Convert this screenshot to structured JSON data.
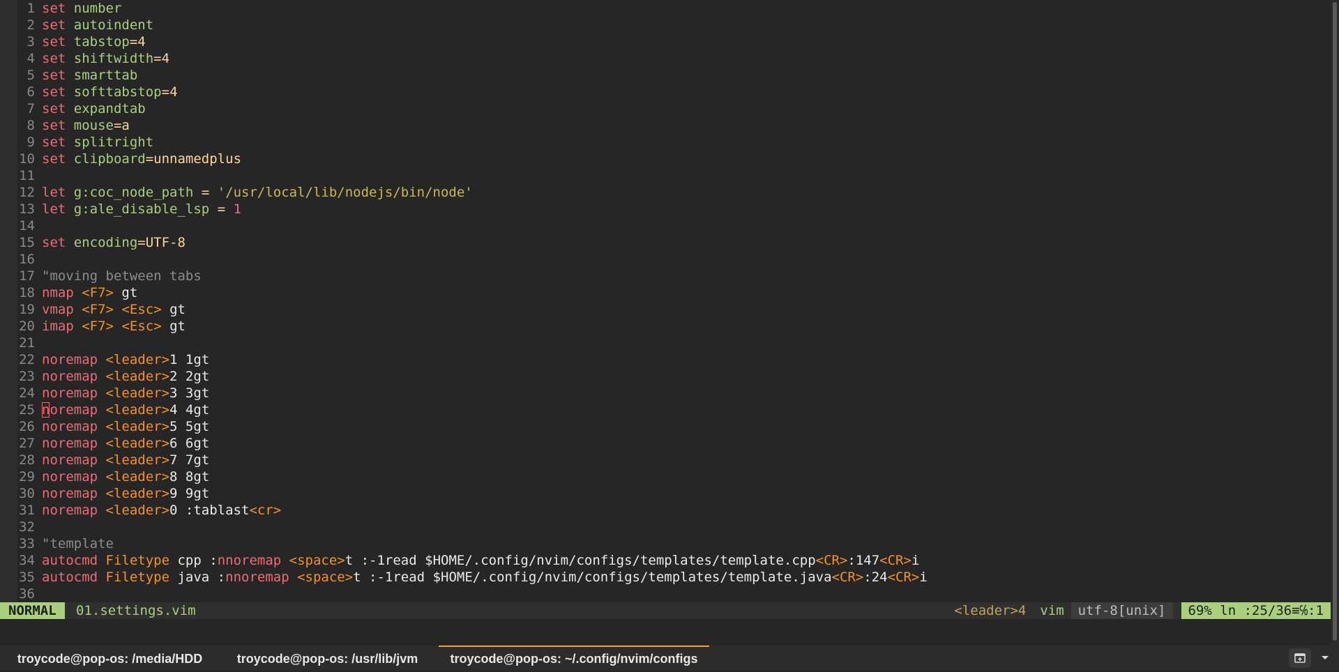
{
  "editor": {
    "lines": [
      {
        "n": "1",
        "segs": [
          [
            "set",
            "kw"
          ],
          [
            " ",
            ""
          ],
          [
            "number",
            "opt"
          ]
        ]
      },
      {
        "n": "2",
        "segs": [
          [
            "set",
            "kw"
          ],
          [
            " ",
            ""
          ],
          [
            "autoindent",
            "opt"
          ]
        ]
      },
      {
        "n": "3",
        "segs": [
          [
            "set",
            "kw"
          ],
          [
            " ",
            ""
          ],
          [
            "tabstop",
            "opt"
          ],
          [
            "=4",
            "eq"
          ]
        ]
      },
      {
        "n": "4",
        "segs": [
          [
            "set",
            "kw"
          ],
          [
            " ",
            ""
          ],
          [
            "shiftwidth",
            "opt"
          ],
          [
            "=4",
            "eq"
          ]
        ]
      },
      {
        "n": "5",
        "segs": [
          [
            "set",
            "kw"
          ],
          [
            " ",
            ""
          ],
          [
            "smarttab",
            "opt"
          ]
        ]
      },
      {
        "n": "6",
        "segs": [
          [
            "set",
            "kw"
          ],
          [
            " ",
            ""
          ],
          [
            "softtabstop",
            "opt"
          ],
          [
            "=4",
            "eq"
          ]
        ]
      },
      {
        "n": "7",
        "segs": [
          [
            "set",
            "kw"
          ],
          [
            " ",
            ""
          ],
          [
            "expandtab",
            "opt"
          ]
        ]
      },
      {
        "n": "8",
        "segs": [
          [
            "set",
            "kw"
          ],
          [
            " ",
            ""
          ],
          [
            "mouse",
            "opt"
          ],
          [
            "=a",
            "eq"
          ]
        ]
      },
      {
        "n": "9",
        "segs": [
          [
            "set",
            "kw"
          ],
          [
            " ",
            ""
          ],
          [
            "splitright",
            "opt"
          ]
        ]
      },
      {
        "n": "10",
        "segs": [
          [
            "set",
            "kw"
          ],
          [
            " ",
            ""
          ],
          [
            "clipboard",
            "opt"
          ],
          [
            "=unnamedplus",
            "eq"
          ]
        ]
      },
      {
        "n": "11",
        "segs": []
      },
      {
        "n": "12",
        "segs": [
          [
            "let",
            "kw"
          ],
          [
            " ",
            ""
          ],
          [
            "g:coc_node_path",
            "opt"
          ],
          [
            " = ",
            "eq"
          ],
          [
            "'/usr/local/lib/nodejs/bin/node'",
            "str"
          ]
        ]
      },
      {
        "n": "13",
        "segs": [
          [
            "let",
            "kw"
          ],
          [
            " ",
            ""
          ],
          [
            "g:ale_disable_lsp",
            "opt"
          ],
          [
            " = ",
            "eq"
          ],
          [
            "1",
            "num"
          ]
        ]
      },
      {
        "n": "14",
        "segs": []
      },
      {
        "n": "15",
        "segs": [
          [
            "set",
            "kw"
          ],
          [
            " ",
            ""
          ],
          [
            "encoding",
            "opt"
          ],
          [
            "=UTF-8",
            "eq"
          ]
        ]
      },
      {
        "n": "16",
        "segs": []
      },
      {
        "n": "17",
        "segs": [
          [
            "\"moving between tabs",
            "cmt"
          ]
        ]
      },
      {
        "n": "18",
        "segs": [
          [
            "nmap",
            "kw"
          ],
          [
            " ",
            ""
          ],
          [
            "<F7>",
            "key"
          ],
          [
            " gt",
            "plain"
          ]
        ]
      },
      {
        "n": "19",
        "segs": [
          [
            "vmap",
            "kw"
          ],
          [
            " ",
            ""
          ],
          [
            "<F7>",
            "key"
          ],
          [
            " ",
            ""
          ],
          [
            "<Esc>",
            "key"
          ],
          [
            " gt",
            "plain"
          ]
        ]
      },
      {
        "n": "20",
        "segs": [
          [
            "imap",
            "kw"
          ],
          [
            " ",
            ""
          ],
          [
            "<F7>",
            "key"
          ],
          [
            " ",
            ""
          ],
          [
            "<Esc>",
            "key"
          ],
          [
            " gt",
            "plain"
          ]
        ]
      },
      {
        "n": "21",
        "segs": []
      },
      {
        "n": "22",
        "segs": [
          [
            "noremap",
            "kw"
          ],
          [
            " ",
            ""
          ],
          [
            "<leader>",
            "key"
          ],
          [
            "1 1gt",
            "plain"
          ]
        ]
      },
      {
        "n": "23",
        "segs": [
          [
            "noremap",
            "kw"
          ],
          [
            " ",
            ""
          ],
          [
            "<leader>",
            "key"
          ],
          [
            "2 2gt",
            "plain"
          ]
        ]
      },
      {
        "n": "24",
        "segs": [
          [
            "noremap",
            "kw"
          ],
          [
            " ",
            ""
          ],
          [
            "<leader>",
            "key"
          ],
          [
            "3 3gt",
            "plain"
          ]
        ]
      },
      {
        "n": "25",
        "segs": [
          [
            "n",
            "kw cursor-char"
          ],
          [
            "oremap",
            "kw"
          ],
          [
            " ",
            ""
          ],
          [
            "<leader>",
            "key"
          ],
          [
            "4 4gt",
            "plain"
          ]
        ]
      },
      {
        "n": "26",
        "segs": [
          [
            "noremap",
            "kw"
          ],
          [
            " ",
            ""
          ],
          [
            "<leader>",
            "key"
          ],
          [
            "5 5gt",
            "plain"
          ]
        ]
      },
      {
        "n": "27",
        "segs": [
          [
            "noremap",
            "kw"
          ],
          [
            " ",
            ""
          ],
          [
            "<leader>",
            "key"
          ],
          [
            "6 6gt",
            "plain"
          ]
        ]
      },
      {
        "n": "28",
        "segs": [
          [
            "noremap",
            "kw"
          ],
          [
            " ",
            ""
          ],
          [
            "<leader>",
            "key"
          ],
          [
            "7 7gt",
            "plain"
          ]
        ]
      },
      {
        "n": "29",
        "segs": [
          [
            "noremap",
            "kw"
          ],
          [
            " ",
            ""
          ],
          [
            "<leader>",
            "key"
          ],
          [
            "8 8gt",
            "plain"
          ]
        ]
      },
      {
        "n": "30",
        "segs": [
          [
            "noremap",
            "kw"
          ],
          [
            " ",
            ""
          ],
          [
            "<leader>",
            "key"
          ],
          [
            "9 9gt",
            "plain"
          ]
        ]
      },
      {
        "n": "31",
        "segs": [
          [
            "noremap",
            "kw"
          ],
          [
            " ",
            ""
          ],
          [
            "<leader>",
            "key"
          ],
          [
            "0 :tablast",
            "plain"
          ],
          [
            "<cr>",
            "key"
          ]
        ]
      },
      {
        "n": "32",
        "segs": []
      },
      {
        "n": "33",
        "segs": [
          [
            "\"template",
            "cmt"
          ]
        ]
      },
      {
        "n": "34",
        "segs": [
          [
            "autocmd",
            "kw"
          ],
          [
            " ",
            ""
          ],
          [
            "Filetype",
            "key"
          ],
          [
            " cpp :",
            "plain"
          ],
          [
            "nnoremap",
            "kw"
          ],
          [
            " ",
            ""
          ],
          [
            "<space>",
            "key"
          ],
          [
            "t :-1read $HOME/.config/nvim/configs/templates/template.cpp",
            "plain"
          ],
          [
            "<CR>",
            "key"
          ],
          [
            ":147",
            "plain"
          ],
          [
            "<CR>",
            "key"
          ],
          [
            "i",
            "plain"
          ]
        ]
      },
      {
        "n": "35",
        "segs": [
          [
            "autocmd",
            "kw"
          ],
          [
            " ",
            ""
          ],
          [
            "Filetype",
            "key"
          ],
          [
            " java :",
            "plain"
          ],
          [
            "nnoremap",
            "kw"
          ],
          [
            " ",
            ""
          ],
          [
            "<space>",
            "key"
          ],
          [
            "t :-1read $HOME/.config/nvim/configs/templates/template.java",
            "plain"
          ],
          [
            "<CR>",
            "key"
          ],
          [
            ":24",
            "plain"
          ],
          [
            "<CR>",
            "key"
          ],
          [
            "i",
            "plain"
          ]
        ]
      },
      {
        "n": "36",
        "segs": []
      }
    ]
  },
  "statusline": {
    "mode": "NORMAL",
    "filename": "01.settings.vim",
    "pending_keys": "<leader>4",
    "filetype": "vim",
    "encoding": "utf-8[unix]",
    "percent": "69%",
    "line_pos": "ln :25/36≡℅:1"
  },
  "tabs": [
    {
      "label": "troycode@pop-os: /media/HDD"
    },
    {
      "label": "troycode@pop-os: /usr/lib/jvm"
    },
    {
      "label": "troycode@pop-os: ~/.config/nvim/configs"
    }
  ],
  "colors": {
    "accent_green": "#a9d17d",
    "keyword_red": "#ef6b73",
    "key_orange": "#f7931e",
    "string_yellow": "#ceb74e",
    "tab_active_underline": "#f2a238"
  },
  "icons": {
    "new_tab": "new-tab-icon",
    "menu": "chevron-down-icon"
  }
}
